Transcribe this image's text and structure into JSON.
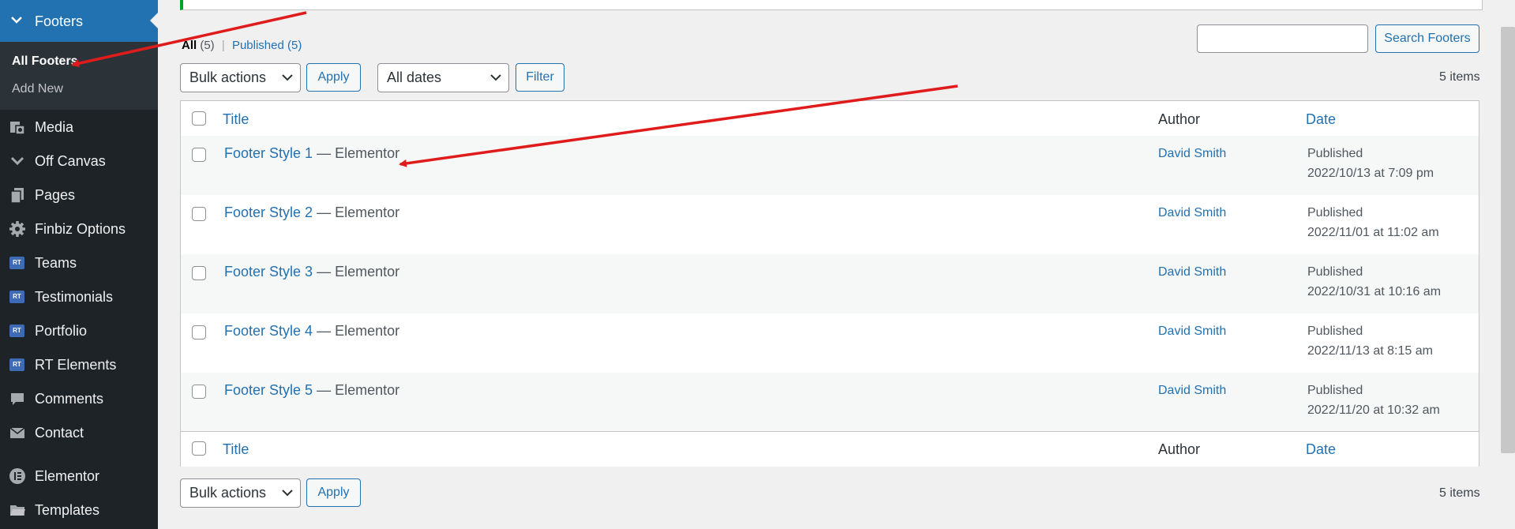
{
  "sidebar": {
    "active": {
      "label": "Footers",
      "icon": "chevron-down-icon"
    },
    "submenu": [
      {
        "label": "All Footers",
        "current": true
      },
      {
        "label": "Add New",
        "current": false
      }
    ],
    "items": [
      {
        "label": "Media",
        "icon": "media-icon"
      },
      {
        "label": "Off Canvas",
        "icon": "chevron-down-icon"
      },
      {
        "label": "Pages",
        "icon": "pages-icon"
      },
      {
        "label": "Finbiz Options",
        "icon": "gear-icon"
      },
      {
        "label": "Teams",
        "icon": "rt-icon",
        "badge": "RT"
      },
      {
        "label": "Testimonials",
        "icon": "rt-icon",
        "badge": "RT"
      },
      {
        "label": "Portfolio",
        "icon": "rt-icon",
        "badge": "RT"
      },
      {
        "label": "RT Elements",
        "icon": "rt-icon",
        "badge": "RT"
      },
      {
        "label": "Comments",
        "icon": "comment-icon"
      },
      {
        "label": "Contact",
        "icon": "mail-icon"
      },
      {
        "label": "Elementor",
        "icon": "elementor-icon"
      },
      {
        "label": "Templates",
        "icon": "folder-icon"
      }
    ]
  },
  "filters": {
    "all_label": "All",
    "all_count": "(5)",
    "separator": "|",
    "published_label": "Published",
    "published_count": "(5)"
  },
  "search": {
    "value": "",
    "button_label": "Search Footers"
  },
  "toolbar": {
    "bulk_actions": "Bulk actions",
    "apply_label": "Apply",
    "dates": "All dates",
    "filter_label": "Filter",
    "items_count": "5 items"
  },
  "table": {
    "columns": {
      "title": "Title",
      "author": "Author",
      "date": "Date"
    },
    "rows": [
      {
        "title": "Footer Style 1",
        "suffix": " — Elementor",
        "author": "David Smith",
        "status": "Published",
        "datetime": "2022/10/13 at 7:09 pm"
      },
      {
        "title": "Footer Style 2",
        "suffix": " — Elementor",
        "author": "David Smith",
        "status": "Published",
        "datetime": "2022/11/01 at 11:02 am"
      },
      {
        "title": "Footer Style 3",
        "suffix": " — Elementor",
        "author": "David Smith",
        "status": "Published",
        "datetime": "2022/10/31 at 10:16 am"
      },
      {
        "title": "Footer Style 4",
        "suffix": " — Elementor",
        "author": "David Smith",
        "status": "Published",
        "datetime": "2022/11/13 at 8:15 am"
      },
      {
        "title": "Footer Style 5",
        "suffix": " — Elementor",
        "author": "David Smith",
        "status": "Published",
        "datetime": "2022/11/20 at 10:32 am"
      }
    ]
  },
  "bottom_toolbar": {
    "bulk_actions": "Bulk actions",
    "apply_label": "Apply",
    "items_count": "5 items"
  },
  "colors": {
    "sidebar_bg": "#1d2327",
    "active_menu": "#2271b1",
    "link": "#2271b1",
    "annotation_arrow": "#e01b1b",
    "notice_border": "#00a32a"
  }
}
